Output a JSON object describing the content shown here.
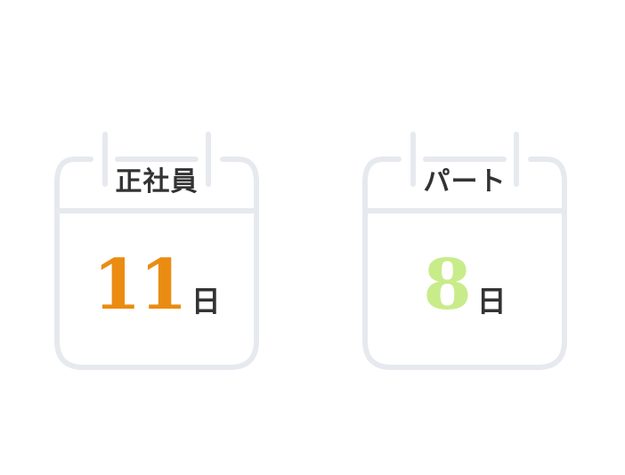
{
  "colors": {
    "frame": "#E6E9EE",
    "text": "#333333",
    "fulltime_number": "#EA8C12",
    "parttime_number": "#C8EC8A"
  },
  "calendars": [
    {
      "label": "正社員",
      "value": "11",
      "unit": "日"
    },
    {
      "label": "パート",
      "value": "8",
      "unit": "日"
    }
  ]
}
